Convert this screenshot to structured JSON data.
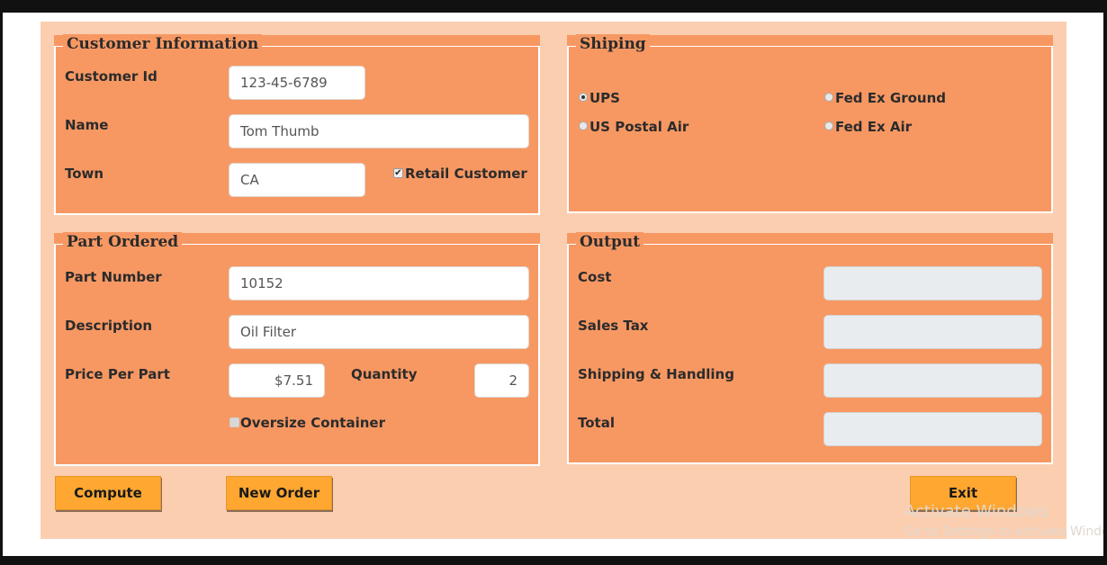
{
  "customer": {
    "legend": "Customer Information",
    "id_label": "Customer Id",
    "id_value": "123-45-6789",
    "name_label": "Name",
    "name_value": "Tom Thumb",
    "town_label": "Town",
    "town_value": "CA",
    "retail_label": "Retail Customer",
    "retail_checked": true
  },
  "shipping": {
    "legend": "Shiping",
    "options": [
      {
        "label": "UPS",
        "selected": true
      },
      {
        "label": "Fed Ex Ground",
        "selected": false
      },
      {
        "label": "US Postal Air",
        "selected": false
      },
      {
        "label": "Fed Ex Air",
        "selected": false
      }
    ]
  },
  "part": {
    "legend": "Part Ordered",
    "number_label": "Part Number",
    "number_value": "10152",
    "description_label": "Description",
    "description_value": "Oil Filter",
    "price_label": "Price Per Part",
    "price_value": "$7.51",
    "quantity_label": "Quantity",
    "quantity_value": "2",
    "oversize_label": "Oversize Container",
    "oversize_checked": false
  },
  "output": {
    "legend": "Output",
    "cost_label": "Cost",
    "sales_tax_label": "Sales Tax",
    "shipping_label": "Shipping & Handling",
    "total_label": "Total",
    "cost_value": "",
    "sales_tax_value": "",
    "shipping_value": "",
    "total_value": ""
  },
  "buttons": {
    "compute": "Compute",
    "new_order": "New Order",
    "exit": "Exit"
  },
  "watermark": {
    "line1": "Activate Windows",
    "line2": "Go to Settings to activate Windows."
  },
  "colors": {
    "panel": "#f79863",
    "background": "#fcceb0",
    "button": "#ffa730"
  }
}
